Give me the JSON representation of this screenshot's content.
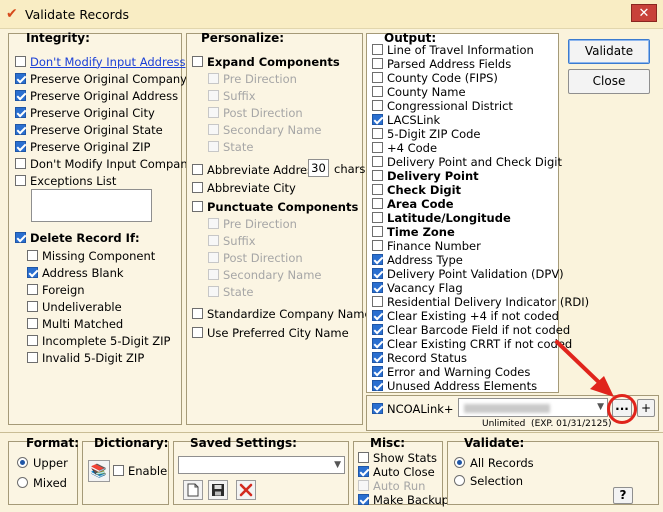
{
  "window": {
    "title": "Validate Records",
    "close_glyph": "✕"
  },
  "integrity": {
    "heading": "Integrity:",
    "options": [
      {
        "label": "Don't Modify Input Address",
        "checked": false,
        "link": true
      },
      {
        "label": "Preserve Original Company",
        "checked": true
      },
      {
        "label": "Preserve Original Address",
        "checked": true
      },
      {
        "label": "Preserve Original City",
        "checked": true
      },
      {
        "label": "Preserve Original State",
        "checked": true
      },
      {
        "label": "Preserve Original ZIP",
        "checked": true
      },
      {
        "label": "Don't Modify Input Company",
        "checked": false
      }
    ],
    "exceptions_label": "Exceptions List",
    "exceptions_value": "",
    "delete_heading": "Delete Record If:",
    "delete_options": [
      {
        "label": "Missing Component",
        "checked": false
      },
      {
        "label": "Address Blank",
        "checked": true
      },
      {
        "label": "Foreign",
        "checked": false
      },
      {
        "label": "Undeliverable",
        "checked": false
      },
      {
        "label": "Multi Matched",
        "checked": false
      },
      {
        "label": "Incomplete 5-Digit ZIP",
        "checked": false
      },
      {
        "label": "Invalid 5-Digit ZIP",
        "checked": false
      }
    ]
  },
  "personalize": {
    "heading": "Personalize:",
    "expand_label": "Expand Components",
    "expand_sub": [
      "Pre Direction",
      "Suffix",
      "Post Direction",
      "Secondary Name",
      "State"
    ],
    "abbrev_address_label": "Abbreviate Address",
    "abbrev_address_chars": "30",
    "chars_label": "chars",
    "abbrev_city_label": "Abbreviate City",
    "punctuate_label": "Punctuate Components",
    "punctuate_sub": [
      "Pre Direction",
      "Suffix",
      "Post Direction",
      "Secondary Name",
      "State"
    ],
    "standardize_label": "Standardize Company Name",
    "preferred_city_label": "Use Preferred City Name"
  },
  "output": {
    "heading": "Output:",
    "items": [
      {
        "label": "Line of Travel Information",
        "checked": false,
        "bold": false
      },
      {
        "label": "Parsed Address Fields",
        "checked": false,
        "bold": false
      },
      {
        "label": "County Code (FIPS)",
        "checked": false,
        "bold": false
      },
      {
        "label": "County Name",
        "checked": false,
        "bold": false
      },
      {
        "label": "Congressional District",
        "checked": false,
        "bold": false
      },
      {
        "label": "LACSLink",
        "checked": true,
        "bold": false
      },
      {
        "label": "5-Digit ZIP Code",
        "checked": false,
        "bold": false
      },
      {
        "label": "+4 Code",
        "checked": false,
        "bold": false
      },
      {
        "label": "Delivery Point and Check Digit",
        "checked": false,
        "bold": false
      },
      {
        "label": "Delivery Point",
        "checked": false,
        "bold": true
      },
      {
        "label": "Check Digit",
        "checked": false,
        "bold": true
      },
      {
        "label": "Area Code",
        "checked": false,
        "bold": true
      },
      {
        "label": "Latitude/Longitude",
        "checked": false,
        "bold": true
      },
      {
        "label": "Time Zone",
        "checked": false,
        "bold": true
      },
      {
        "label": "Finance Number",
        "checked": false,
        "bold": false
      },
      {
        "label": "Address Type",
        "checked": true,
        "bold": false
      },
      {
        "label": "Delivery Point Validation (DPV)",
        "checked": true,
        "bold": false
      },
      {
        "label": "Vacancy Flag",
        "checked": true,
        "bold": false
      },
      {
        "label": "Residential Delivery Indicator (RDI)",
        "checked": false,
        "bold": false
      },
      {
        "label": "Clear Existing +4 if not coded",
        "checked": true,
        "bold": false
      },
      {
        "label": "Clear Barcode Field if not coded",
        "checked": true,
        "bold": false
      },
      {
        "label": "Clear Existing CRRT if not coded",
        "checked": true,
        "bold": false
      },
      {
        "label": "Record Status",
        "checked": true,
        "bold": false
      },
      {
        "label": "Error and Warning Codes",
        "checked": true,
        "bold": false
      },
      {
        "label": "Unused Address Elements",
        "checked": true,
        "bold": false
      }
    ],
    "ncoa_label": "NCOALink+",
    "ncoa_checked": true,
    "ncoa_dropdown_value": "",
    "ellipsis_label": "...",
    "plus_label": "+",
    "license_text": "Unlimited  (EXP. 01/31/2125)"
  },
  "actions": {
    "validate_label": "Validate",
    "close_label": "Close"
  },
  "format": {
    "heading": "Format:",
    "options": [
      {
        "label": "Upper",
        "selected": true
      },
      {
        "label": "Mixed",
        "selected": false
      }
    ]
  },
  "dictionary": {
    "heading": "Dictionary:",
    "enable_label": "Enable",
    "enable_checked": false
  },
  "saved_settings": {
    "heading": "Saved Settings:",
    "selected_value": ""
  },
  "misc": {
    "heading": "Misc:",
    "items": [
      {
        "label": "Show Stats",
        "checked": false,
        "disabled": false
      },
      {
        "label": "Auto Close",
        "checked": true,
        "disabled": false
      },
      {
        "label": "Auto Run",
        "checked": false,
        "disabled": true
      },
      {
        "label": "Make Backup",
        "checked": true,
        "disabled": false
      }
    ]
  },
  "validate_group": {
    "heading": "Validate:",
    "options": [
      {
        "label": "All Records",
        "selected": true
      },
      {
        "label": "Selection",
        "selected": false
      }
    ]
  },
  "help_label": "?",
  "colors": {
    "window_bg": "#faf3dc",
    "title_bg": "#f9edc4",
    "check_blue": "#2a6fd0",
    "annotation_red": "#e0241c",
    "link_blue": "#1a3fd6"
  }
}
